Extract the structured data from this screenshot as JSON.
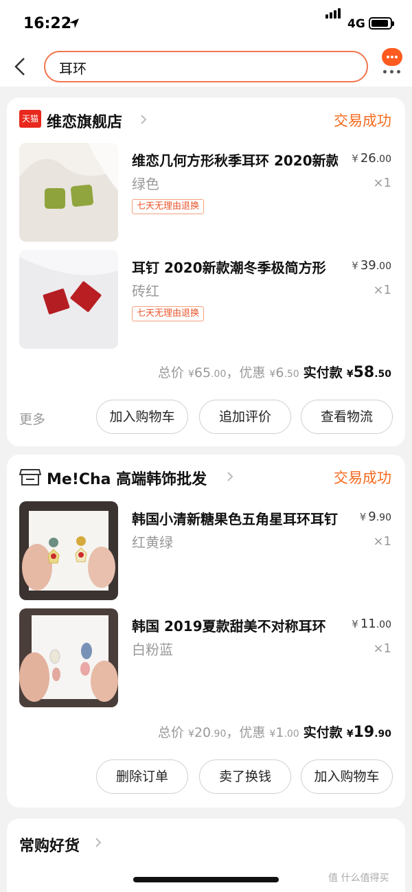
{
  "status_bar": {
    "time": "16:22",
    "network": "4G"
  },
  "search": {
    "query": "耳环"
  },
  "orders": [
    {
      "shop_name": "维恋旗舰店",
      "shop_badge": "天猫",
      "status": "交易成功",
      "items": [
        {
          "title": "维恋几何方形秋季耳环 2020新款",
          "variant": "绿色",
          "currency": "¥",
          "price_int": "26",
          "price_dec": ".00",
          "qty": "×1",
          "tag": "七天无理由退换"
        },
        {
          "title": "耳钉 2020新款潮冬季极简方形",
          "variant": "砖红",
          "currency": "¥",
          "price_int": "39",
          "price_dec": ".00",
          "qty": "×1",
          "tag": "七天无理由退换"
        }
      ],
      "totals": {
        "total_label": "总价",
        "total_int": "65",
        "total_dec": ".00",
        "discount_label": "，优惠",
        "discount_int": "6",
        "discount_dec": ".50",
        "paid_label": "实付款",
        "paid_int": "58",
        "paid_dec": ".50",
        "currency": "¥"
      },
      "more_label": "更多",
      "actions": [
        "加入购物车",
        "追加评价",
        "查看物流"
      ]
    },
    {
      "shop_name": "Me!Cha 高端韩饰批发",
      "status": "交易成功",
      "items": [
        {
          "title": "韩国小清新糖果色五角星耳环耳钉",
          "variant": "红黄绿",
          "currency": "¥",
          "price_int": "9",
          "price_dec": ".90",
          "qty": "×1"
        },
        {
          "title": "韩国 2019夏款甜美不对称耳环",
          "variant": "白粉蓝",
          "currency": "¥",
          "price_int": "11",
          "price_dec": ".00",
          "qty": "×1"
        }
      ],
      "totals": {
        "total_label": "总价",
        "total_int": "20",
        "total_dec": ".90",
        "discount_label": "，优惠",
        "discount_int": "1",
        "discount_dec": ".00",
        "paid_label": "实付款",
        "paid_int": "19",
        "paid_dec": ".90",
        "currency": "¥"
      },
      "actions": [
        "删除订单",
        "卖了换钱",
        "加入购物车"
      ]
    }
  ],
  "frequent": {
    "title": "常购好货"
  },
  "watermark": "值 什么值得买",
  "colors": {
    "accent": "#f56a1e",
    "search_border": "#f2774f",
    "tmall_red": "#e8281c"
  }
}
